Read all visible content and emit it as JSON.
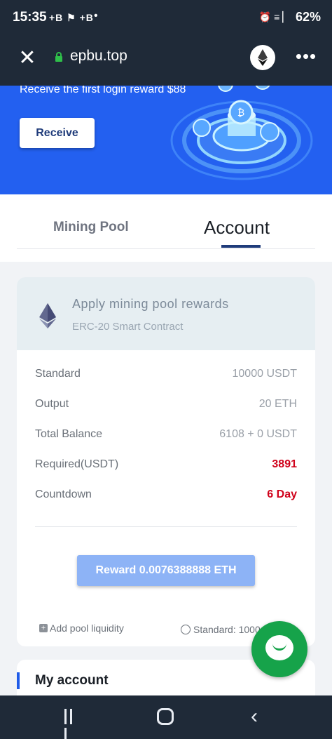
{
  "status_bar": {
    "time": "15:35",
    "notifications": "+B ⚑ +B",
    "dot": "•",
    "system_icons": "⏰ ≡ ▏",
    "battery": "62%"
  },
  "browser": {
    "close_glyph": "✕",
    "url": "epbu.top",
    "more_glyph": "•••"
  },
  "banner": {
    "message": "Receive the first login reward $88",
    "receive_label": "Receive"
  },
  "tabs": {
    "mining_pool": "Mining Pool",
    "account": "Account",
    "active": "account"
  },
  "pool_card": {
    "title": "Apply mining pool rewards",
    "subtitle": "ERC-20 Smart Contract",
    "rows": [
      {
        "label": "Standard",
        "value": "10000 USDT"
      },
      {
        "label": "Output",
        "value": "20 ETH"
      },
      {
        "label": "Total Balance",
        "value": "6108 + 0 USDT"
      },
      {
        "label": "Required(USDT)",
        "value": "3891"
      },
      {
        "label": "Countdown",
        "value": "6 Day"
      }
    ],
    "reward_button": "Reward 0.0076388888 ETH",
    "add_pool": "Add pool liquidity",
    "standard_note": "Standard: 1000"
  },
  "my_account": {
    "title": "My account"
  },
  "colors": {
    "brand_blue": "#2360f0",
    "dark_bar": "#1f2a38",
    "alert_red": "#d0021b",
    "chat_green": "#16a34a",
    "reward_button": "#8db3f6"
  },
  "icons": [
    "close-icon",
    "lock-icon",
    "ethereum-icon",
    "more-icon",
    "plus-icon",
    "settings-icon",
    "chat-icon",
    "recents-icon",
    "home-icon",
    "back-icon"
  ]
}
